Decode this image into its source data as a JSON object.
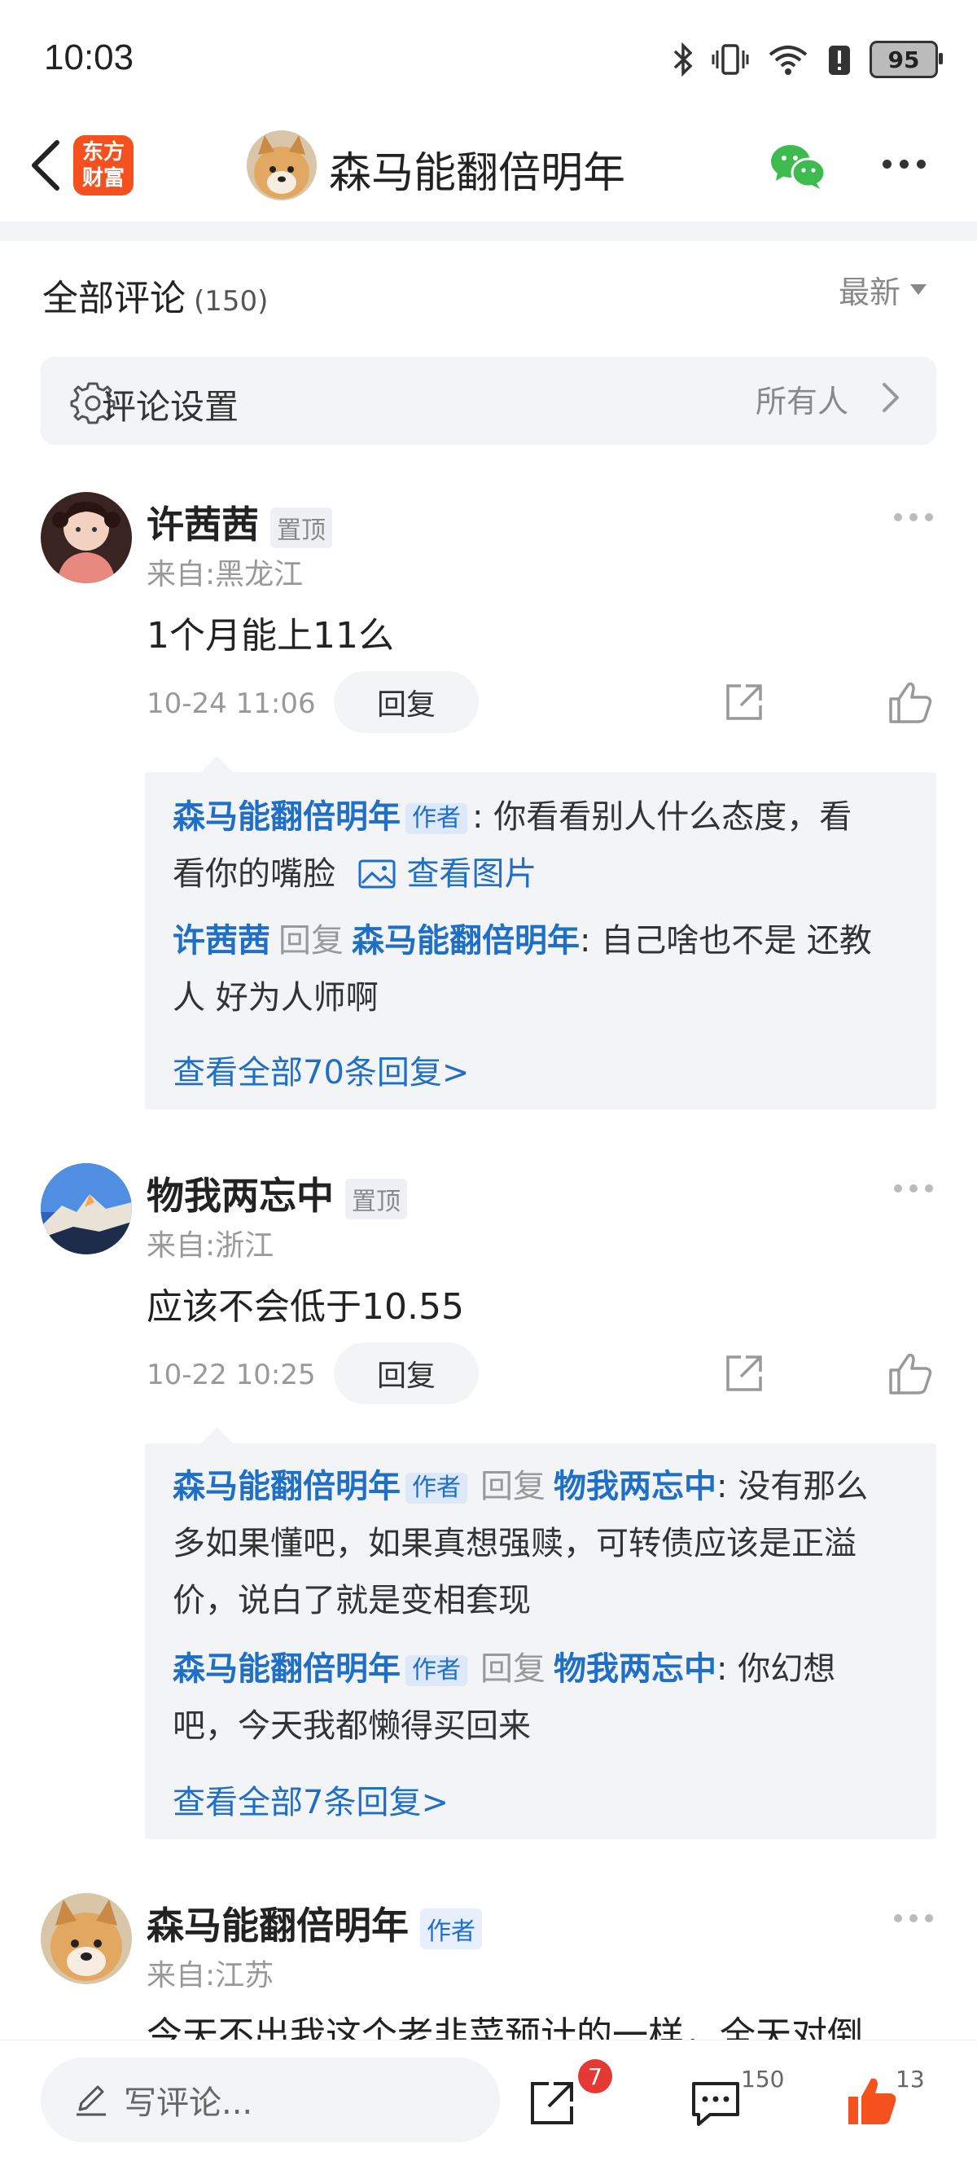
{
  "status_bar": {
    "time": "10:03",
    "battery": "95"
  },
  "header": {
    "logo_line1": "东方",
    "logo_line2": "财富",
    "title": "森马能翻倍明年"
  },
  "comments_header": {
    "title": "全部评论",
    "count": "(150)",
    "sort_label": "最新"
  },
  "settings": {
    "label": "评论设置",
    "value": "所有人"
  },
  "comments": [
    {
      "name": "许茜茜",
      "tag": "置顶",
      "location": "来自:黑龙江",
      "text": "1个月能上11么",
      "date": "10-24 11:06",
      "reply_label": "回复",
      "replies": [
        {
          "name": "森马能翻倍明年",
          "tag": "作者",
          "sep": ":",
          "text1": " 你看看别人什么态度，看",
          "text2": "看你的嘴脸",
          "image_label": "查看图片"
        },
        {
          "name": "许茜茜",
          "reply_word": "回复",
          "target": "森马能翻倍明年",
          "sep": ":",
          "text1": " 自己啥也不是 还教",
          "text2": "人 好为人师啊"
        }
      ],
      "view_all": "查看全部70条回复>"
    },
    {
      "name": "物我两忘中",
      "tag": "置顶",
      "location": "来自:浙江",
      "text": "应该不会低于10.55",
      "date": "10-22 10:25",
      "reply_label": "回复",
      "replies": [
        {
          "name": "森马能翻倍明年",
          "tag": "作者",
          "reply_word": "回复",
          "target": "物我两忘中",
          "sep": ":",
          "text1": " 没有那么",
          "text2": "多如果懂吧，如果真想强赎，可转债应该是正溢",
          "text3": "价，说白了就是变相套现"
        },
        {
          "name": "森马能翻倍明年",
          "tag": "作者",
          "reply_word": "回复",
          "target": "物我两忘中",
          "sep": ":",
          "text1": " 你幻想",
          "text2": "吧，今天我都懒得买回来"
        }
      ],
      "view_all": "查看全部7条回复>"
    },
    {
      "name": "森马能翻倍明年",
      "tag": "作者",
      "location": "来自:江苏",
      "text": "今天不出我这个老韭菜预计的一样，全天对倒"
    }
  ],
  "bottom_bar": {
    "placeholder": "写评论...",
    "share_badge": "7",
    "comment_count": "150",
    "like_count": "13"
  },
  "colors": {
    "link_blue": "#1f6fc6",
    "brand_orange": "#f4511e",
    "like_orange": "#f4511e",
    "badge_red": "#e53935"
  },
  "icons": [
    "back-icon",
    "bluetooth-icon",
    "vibrate-icon",
    "wifi-icon",
    "alert-icon",
    "battery-icon",
    "wechat-icon",
    "more-icon",
    "gear-icon",
    "chevron-right-icon",
    "share-icon",
    "like-icon",
    "image-icon",
    "edit-icon",
    "comment-icon"
  ]
}
